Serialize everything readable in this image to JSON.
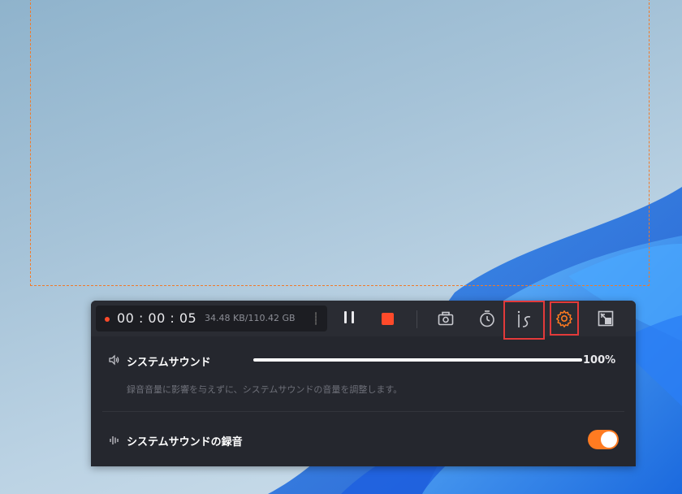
{
  "toolbar": {
    "timer": "00 : 00 : 05",
    "file_size": "34.48 KB/110.42 GB"
  },
  "audio": {
    "system_sound_label": "システムサウンド",
    "volume_percent_label": "100%",
    "volume_fraction": 1.0,
    "description": "録音音量に影響を与えずに、システムサウンドの音量を調整します。",
    "record_system_sound_label": "システムサウンドの録音",
    "record_system_sound_enabled": true
  },
  "colors": {
    "accent": "#ff7b21",
    "record_red": "#ff4a2a",
    "highlight_box": "#e23a3a",
    "panel_bg": "#25272e",
    "capture_border": "#f07a2a"
  },
  "icons": [
    "record-dot-icon",
    "pause-icon",
    "stop-icon",
    "screenshot-icon",
    "timer-icon",
    "annotation-icon",
    "settings-gear-icon",
    "minimize-icon",
    "speaker-icon",
    "audio-bars-icon"
  ]
}
